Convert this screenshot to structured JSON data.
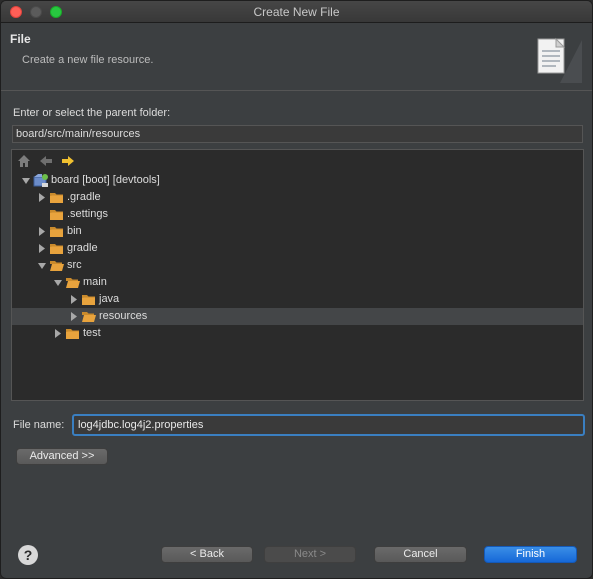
{
  "window": {
    "title": "Create New File"
  },
  "header": {
    "title": "File",
    "description": "Create a new file resource."
  },
  "parent_folder": {
    "label": "Enter or select the parent folder:",
    "value": "board/src/main/resources"
  },
  "tree": {
    "items": [
      {
        "label": "board [boot] [devtools]",
        "depth": 0,
        "expanded": true,
        "has_children": true,
        "icon": "project-icon"
      },
      {
        "label": ".gradle",
        "depth": 1,
        "expanded": false,
        "has_children": true,
        "icon": "folder-icon"
      },
      {
        "label": ".settings",
        "depth": 1,
        "expanded": false,
        "has_children": false,
        "icon": "folder-icon"
      },
      {
        "label": "bin",
        "depth": 1,
        "expanded": false,
        "has_children": true,
        "icon": "folder-icon"
      },
      {
        "label": "gradle",
        "depth": 1,
        "expanded": false,
        "has_children": true,
        "icon": "folder-icon"
      },
      {
        "label": "src",
        "depth": 1,
        "expanded": true,
        "has_children": true,
        "icon": "folder-open-icon"
      },
      {
        "label": "main",
        "depth": 2,
        "expanded": true,
        "has_children": true,
        "icon": "folder-open-icon"
      },
      {
        "label": "java",
        "depth": 3,
        "expanded": false,
        "has_children": true,
        "icon": "folder-icon"
      },
      {
        "label": "resources",
        "depth": 3,
        "expanded": false,
        "has_children": true,
        "icon": "folder-open-icon",
        "selected": true
      },
      {
        "label": "test",
        "depth": 2,
        "expanded": false,
        "has_children": true,
        "icon": "folder-icon"
      }
    ]
  },
  "file_name": {
    "label": "File name:",
    "value": "log4jdbc.log4j2.properties"
  },
  "buttons": {
    "advanced": "Advanced >>",
    "back": "< Back",
    "next": "Next >",
    "cancel": "Cancel",
    "finish": "Finish"
  },
  "colors": {
    "accent": "#1668d8",
    "folder": "#e8a33d",
    "selection": "#444648"
  }
}
